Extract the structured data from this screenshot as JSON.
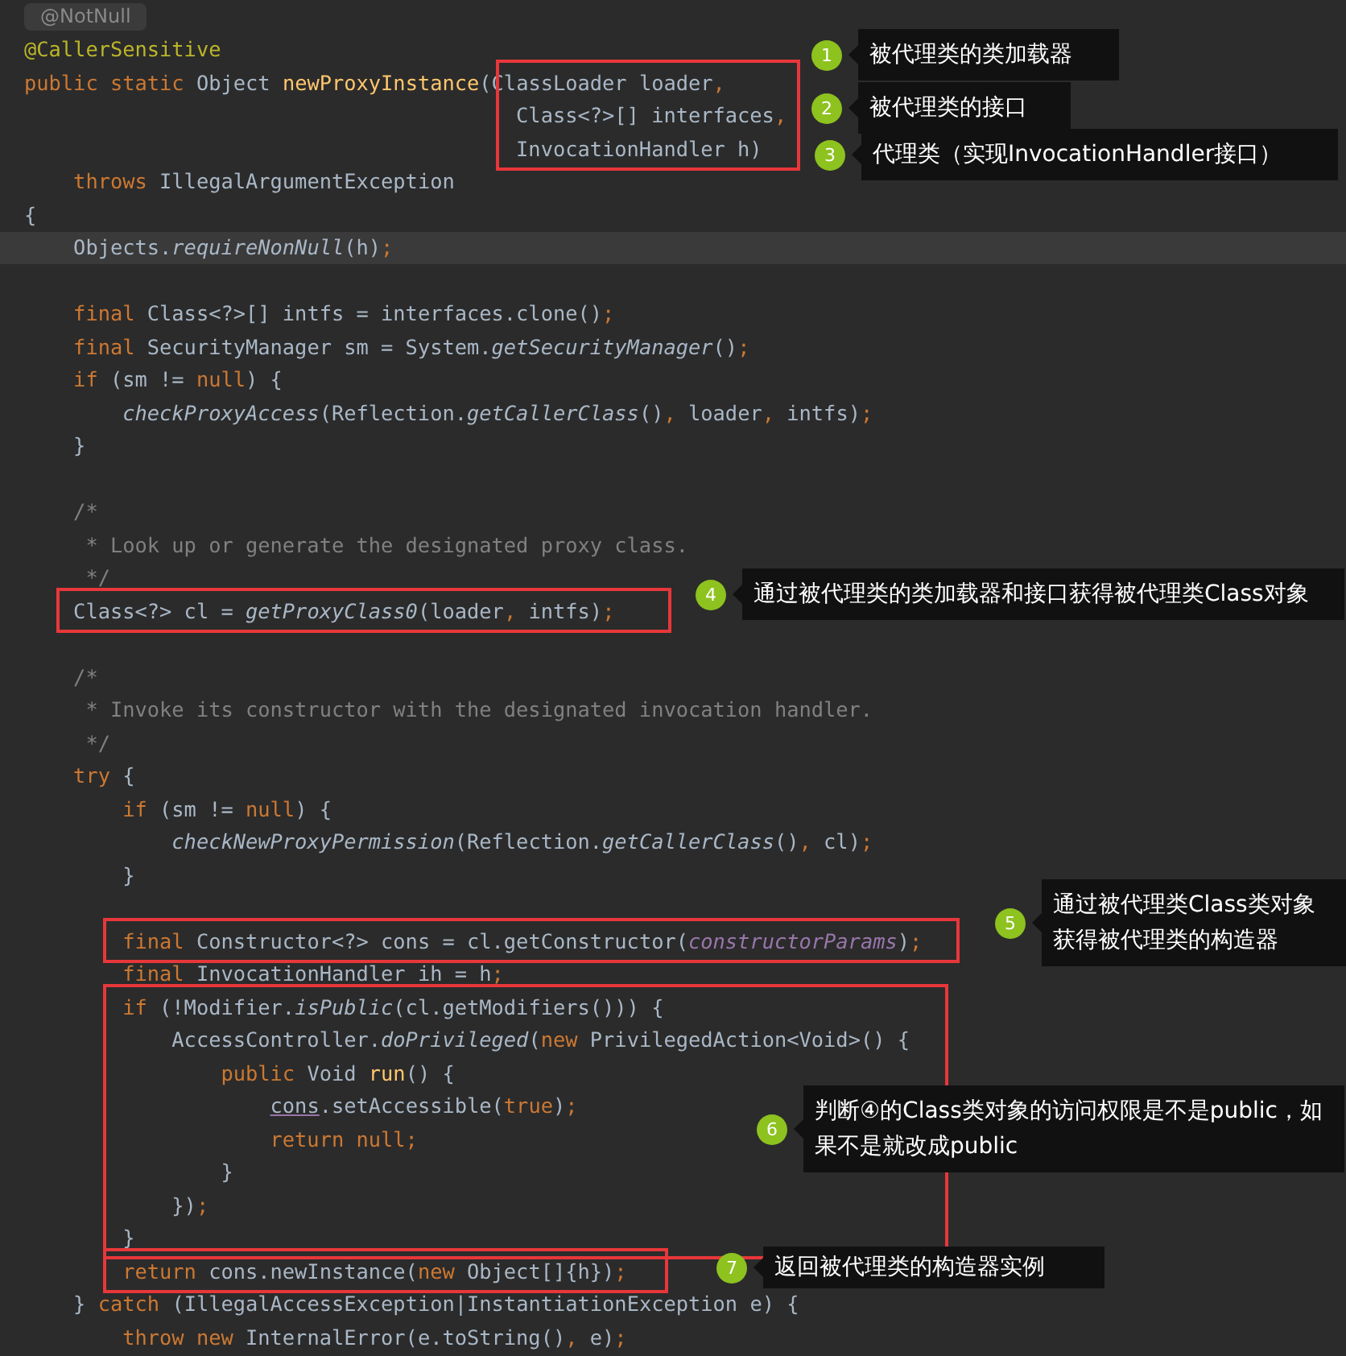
{
  "editor": {
    "lines": [
      {
        "kind": "hint",
        "tokens": [
          {
            "kind": "hint",
            "text": "@NotNull"
          }
        ]
      },
      {
        "kind": "code",
        "current": false,
        "tokens": [
          {
            "kind": "ann",
            "text": "@CallerSensitive"
          }
        ]
      },
      {
        "kind": "code",
        "current": false,
        "tokens": [
          {
            "kind": "kw",
            "text": "public static "
          },
          {
            "kind": "plain",
            "text": "Object "
          },
          {
            "kind": "decl",
            "text": "newProxyInstance"
          },
          {
            "kind": "plain",
            "text": "(ClassLoader loader"
          },
          {
            "kind": "kw",
            "text": ","
          }
        ]
      },
      {
        "kind": "code",
        "current": false,
        "tokens": [
          {
            "kind": "plain",
            "text": "                                        Class<?>[] interfaces"
          },
          {
            "kind": "kw",
            "text": ","
          }
        ]
      },
      {
        "kind": "code",
        "current": false,
        "tokens": [
          {
            "kind": "plain",
            "text": "                                        InvocationHandler h)"
          }
        ]
      },
      {
        "kind": "code",
        "current": false,
        "tokens": [
          {
            "kind": "kw",
            "text": "    throws "
          },
          {
            "kind": "plain",
            "text": "IllegalArgumentException"
          }
        ]
      },
      {
        "kind": "code",
        "current": false,
        "tokens": [
          {
            "kind": "plain",
            "text": "{"
          }
        ]
      },
      {
        "kind": "code",
        "current": true,
        "tokens": [
          {
            "kind": "plain",
            "text": "    Objects."
          },
          {
            "kind": "italic",
            "text": "requireNonNull"
          },
          {
            "kind": "plain",
            "text": "(h)"
          },
          {
            "kind": "kw",
            "text": ";"
          }
        ]
      },
      {
        "kind": "blank"
      },
      {
        "kind": "code",
        "current": false,
        "tokens": [
          {
            "kind": "kw",
            "text": "    final "
          },
          {
            "kind": "plain",
            "text": "Class<?>[] intfs = interfaces.clone()"
          },
          {
            "kind": "kw",
            "text": ";"
          }
        ]
      },
      {
        "kind": "code",
        "current": false,
        "tokens": [
          {
            "kind": "kw",
            "text": "    final "
          },
          {
            "kind": "plain",
            "text": "SecurityManager sm = System."
          },
          {
            "kind": "italic",
            "text": "getSecurityManager"
          },
          {
            "kind": "plain",
            "text": "()"
          },
          {
            "kind": "kw",
            "text": ";"
          }
        ]
      },
      {
        "kind": "code",
        "current": false,
        "tokens": [
          {
            "kind": "kw",
            "text": "    if "
          },
          {
            "kind": "plain",
            "text": "(sm != "
          },
          {
            "kind": "kw",
            "text": "null"
          },
          {
            "kind": "plain",
            "text": ") {"
          }
        ]
      },
      {
        "kind": "code",
        "current": false,
        "tokens": [
          {
            "kind": "italic",
            "text": "        checkProxyAccess"
          },
          {
            "kind": "plain",
            "text": "(Reflection."
          },
          {
            "kind": "italic",
            "text": "getCallerClass"
          },
          {
            "kind": "plain",
            "text": "()"
          },
          {
            "kind": "kw",
            "text": ", "
          },
          {
            "kind": "plain",
            "text": "loader"
          },
          {
            "kind": "kw",
            "text": ", "
          },
          {
            "kind": "plain",
            "text": "intfs)"
          },
          {
            "kind": "kw",
            "text": ";"
          }
        ]
      },
      {
        "kind": "code",
        "current": false,
        "tokens": [
          {
            "kind": "plain",
            "text": "    }"
          }
        ]
      },
      {
        "kind": "blank"
      },
      {
        "kind": "code",
        "current": false,
        "tokens": [
          {
            "kind": "comment",
            "text": "    /*"
          }
        ]
      },
      {
        "kind": "code",
        "current": false,
        "tokens": [
          {
            "kind": "comment",
            "text": "     * Look up or generate the designated proxy class."
          }
        ]
      },
      {
        "kind": "code",
        "current": false,
        "tokens": [
          {
            "kind": "comment",
            "text": "     */"
          }
        ]
      },
      {
        "kind": "code",
        "current": false,
        "tokens": [
          {
            "kind": "plain",
            "text": "    Class<?> cl = "
          },
          {
            "kind": "italic",
            "text": "getProxyClass0"
          },
          {
            "kind": "plain",
            "text": "(loader"
          },
          {
            "kind": "kw",
            "text": ", "
          },
          {
            "kind": "plain",
            "text": "intfs)"
          },
          {
            "kind": "kw",
            "text": ";"
          }
        ]
      },
      {
        "kind": "blank"
      },
      {
        "kind": "code",
        "current": false,
        "tokens": [
          {
            "kind": "comment",
            "text": "    /*"
          }
        ]
      },
      {
        "kind": "code",
        "current": false,
        "tokens": [
          {
            "kind": "comment",
            "text": "     * Invoke its constructor with the designated invocation handler."
          }
        ]
      },
      {
        "kind": "code",
        "current": false,
        "tokens": [
          {
            "kind": "comment",
            "text": "     */"
          }
        ]
      },
      {
        "kind": "code",
        "current": false,
        "tokens": [
          {
            "kind": "kw",
            "text": "    try "
          },
          {
            "kind": "plain",
            "text": "{"
          }
        ]
      },
      {
        "kind": "code",
        "current": false,
        "tokens": [
          {
            "kind": "kw",
            "text": "        if "
          },
          {
            "kind": "plain",
            "text": "(sm != "
          },
          {
            "kind": "kw",
            "text": "null"
          },
          {
            "kind": "plain",
            "text": ") {"
          }
        ]
      },
      {
        "kind": "code",
        "current": false,
        "tokens": [
          {
            "kind": "italic",
            "text": "            checkNewProxyPermission"
          },
          {
            "kind": "plain",
            "text": "(Reflection."
          },
          {
            "kind": "italic",
            "text": "getCallerClass"
          },
          {
            "kind": "plain",
            "text": "()"
          },
          {
            "kind": "kw",
            "text": ", "
          },
          {
            "kind": "plain",
            "text": "cl)"
          },
          {
            "kind": "kw",
            "text": ";"
          }
        ]
      },
      {
        "kind": "code",
        "current": false,
        "tokens": [
          {
            "kind": "plain",
            "text": "        }"
          }
        ]
      },
      {
        "kind": "blank"
      },
      {
        "kind": "code",
        "current": false,
        "tokens": [
          {
            "kind": "kw",
            "text": "        final "
          },
          {
            "kind": "plain",
            "text": "Constructor<?> cons = cl.getConstructor("
          },
          {
            "kind": "param",
            "text": "constructorParams"
          },
          {
            "kind": "plain",
            "text": ")"
          },
          {
            "kind": "kw",
            "text": ";"
          }
        ]
      },
      {
        "kind": "code",
        "current": false,
        "tokens": [
          {
            "kind": "kw",
            "text": "        final "
          },
          {
            "kind": "plain",
            "text": "InvocationHandler ih = h"
          },
          {
            "kind": "kw",
            "text": ";"
          }
        ]
      },
      {
        "kind": "code",
        "current": false,
        "tokens": [
          {
            "kind": "kw",
            "text": "        if "
          },
          {
            "kind": "plain",
            "text": "(!Modifier."
          },
          {
            "kind": "italic",
            "text": "isPublic"
          },
          {
            "kind": "plain",
            "text": "(cl.getModifiers())) {"
          }
        ]
      },
      {
        "kind": "code",
        "current": false,
        "tokens": [
          {
            "kind": "plain",
            "text": "            AccessController."
          },
          {
            "kind": "italic",
            "text": "doPrivileged"
          },
          {
            "kind": "plain",
            "text": "("
          },
          {
            "kind": "kw",
            "text": "new "
          },
          {
            "kind": "plain",
            "text": "PrivilegedAction<Void>() {"
          }
        ]
      },
      {
        "kind": "code",
        "current": false,
        "tokens": [
          {
            "kind": "kw",
            "text": "                public "
          },
          {
            "kind": "plain",
            "text": "Void "
          },
          {
            "kind": "decl",
            "text": "run"
          },
          {
            "kind": "plain",
            "text": "() {"
          }
        ]
      },
      {
        "kind": "code",
        "current": false,
        "tokens": [
          {
            "kind": "under",
            "text": "                    cons"
          },
          {
            "kind": "plain",
            "text": ".setAccessible("
          },
          {
            "kind": "kw",
            "text": "true"
          },
          {
            "kind": "plain",
            "text": ")"
          },
          {
            "kind": "kw",
            "text": ";"
          }
        ]
      },
      {
        "kind": "code",
        "current": false,
        "tokens": [
          {
            "kind": "kw",
            "text": "                    return null;"
          }
        ]
      },
      {
        "kind": "code",
        "current": false,
        "tokens": [
          {
            "kind": "plain",
            "text": "                }"
          }
        ]
      },
      {
        "kind": "code",
        "current": false,
        "tokens": [
          {
            "kind": "plain",
            "text": "            })"
          },
          {
            "kind": "kw",
            "text": ";"
          }
        ]
      },
      {
        "kind": "code",
        "current": false,
        "tokens": [
          {
            "kind": "plain",
            "text": "        }"
          }
        ]
      },
      {
        "kind": "code",
        "current": false,
        "tokens": [
          {
            "kind": "kw",
            "text": "        return "
          },
          {
            "kind": "plain",
            "text": "cons.newInstance("
          },
          {
            "kind": "kw",
            "text": "new "
          },
          {
            "kind": "plain",
            "text": "Object[]{h})"
          },
          {
            "kind": "kw",
            "text": ";"
          }
        ]
      },
      {
        "kind": "code",
        "current": false,
        "tokens": [
          {
            "kind": "plain",
            "text": "    } "
          },
          {
            "kind": "kw",
            "text": "catch "
          },
          {
            "kind": "plain",
            "text": "(IllegalAccessException|InstantiationException e) {"
          }
        ]
      },
      {
        "kind": "code",
        "current": false,
        "tokens": [
          {
            "kind": "kw",
            "text": "        throw new "
          },
          {
            "kind": "plain",
            "text": "InternalError(e.toString()"
          },
          {
            "kind": "kw",
            "text": ", "
          },
          {
            "kind": "plain",
            "text": "e)"
          },
          {
            "kind": "kw",
            "text": ";"
          }
        ]
      }
    ]
  },
  "annotations": [
    {
      "number": "1",
      "text": "被代理类的类加载器"
    },
    {
      "number": "2",
      "text": "被代理类的接口"
    },
    {
      "number": "3",
      "text": "代理类（实现InvocationHandler接口）"
    },
    {
      "number": "4",
      "text": "通过被代理类的类加载器和接口获得被代理类Class对象"
    },
    {
      "number": "5",
      "text": "通过被代理类Class类对象获得被代理类的构造器"
    },
    {
      "number": "6",
      "text": "判断④的Class类对象的访问权限是不是public，如果不是就改成public"
    },
    {
      "number": "7",
      "text": "返回被代理类的构造器实例"
    }
  ]
}
